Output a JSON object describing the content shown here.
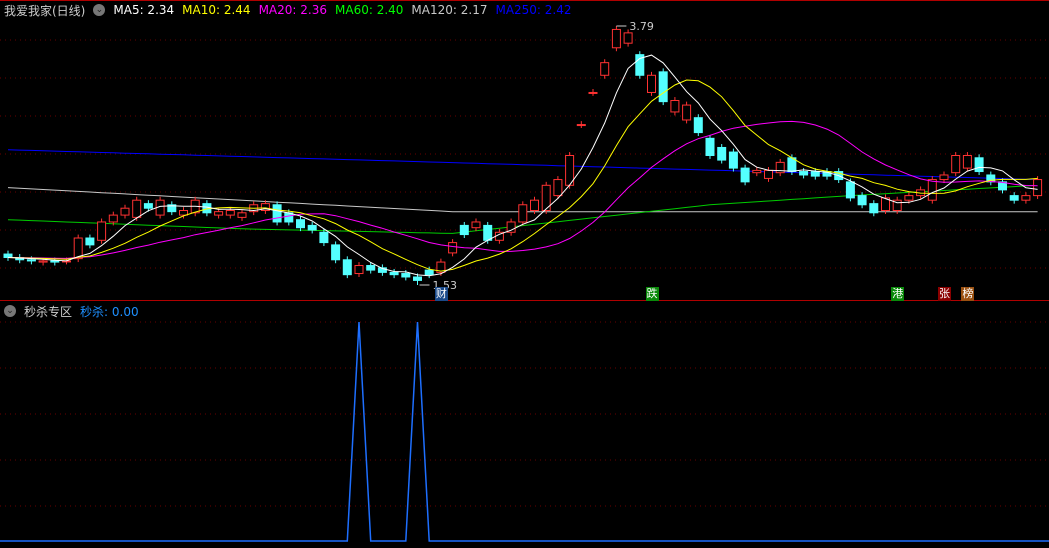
{
  "header": {
    "title": "我爱我家(日线)",
    "ma": [
      {
        "label": "MA5: 2.34",
        "color": "#ffffff"
      },
      {
        "label": "MA10: 2.44",
        "color": "#ffff00"
      },
      {
        "label": "MA20: 2.36",
        "color": "#ff00ff"
      },
      {
        "label": "MA60: 2.40",
        "color": "#00ff00"
      },
      {
        "label": "MA120: 2.17",
        "color": "#c8c8c8"
      },
      {
        "label": "MA250: 2.42",
        "color": "#0000ff"
      }
    ]
  },
  "lower_header": {
    "title": "秒杀专区",
    "indicator": "秒杀: 0.00",
    "indicator_color": "#1e90ff"
  },
  "annotations": {
    "high_label": "3.79",
    "low_label": "1.53"
  },
  "markers": [
    {
      "text": "财",
      "index": 37,
      "color": "#1a4a8a"
    },
    {
      "text": "跌",
      "index": 55,
      "color": "#0a8a0a"
    },
    {
      "text": "港",
      "index": 76,
      "color": "#0a8a0a"
    },
    {
      "text": "张",
      "index": 80,
      "color": "#8b0000"
    },
    {
      "text": "榜",
      "index": 82,
      "color": "#9a5010"
    }
  ],
  "chart_data": {
    "type": "candlestick",
    "price_range": [
      1.53,
      3.79
    ],
    "candles_open_close": [
      [
        1.8,
        1.77
      ],
      [
        1.77,
        1.75
      ],
      [
        1.75,
        1.74
      ],
      [
        1.73,
        1.74
      ],
      [
        1.74,
        1.73
      ],
      [
        1.74,
        1.74
      ],
      [
        1.76,
        1.94
      ],
      [
        1.94,
        1.88
      ],
      [
        1.92,
        2.08
      ],
      [
        2.08,
        2.14
      ],
      [
        2.14,
        2.2
      ],
      [
        2.12,
        2.27
      ],
      [
        2.24,
        2.2
      ],
      [
        2.14,
        2.27
      ],
      [
        2.23,
        2.17
      ],
      [
        2.14,
        2.18
      ],
      [
        2.16,
        2.27
      ],
      [
        2.24,
        2.16
      ],
      [
        2.14,
        2.17
      ],
      [
        2.14,
        2.18
      ],
      [
        2.12,
        2.16
      ],
      [
        2.17,
        2.23
      ],
      [
        2.18,
        2.24
      ],
      [
        2.23,
        2.08
      ],
      [
        2.16,
        2.08
      ],
      [
        2.1,
        2.03
      ],
      [
        2.05,
        2.01
      ],
      [
        1.99,
        1.9
      ],
      [
        1.88,
        1.75
      ],
      [
        1.75,
        1.62
      ],
      [
        1.63,
        1.7
      ],
      [
        1.7,
        1.66
      ],
      [
        1.68,
        1.64
      ],
      [
        1.64,
        1.62
      ],
      [
        1.63,
        1.6
      ],
      [
        1.6,
        1.57
      ],
      [
        1.66,
        1.62
      ],
      [
        1.64,
        1.73
      ],
      [
        1.81,
        1.9
      ],
      [
        2.05,
        1.97
      ],
      [
        2.03,
        2.08
      ],
      [
        2.05,
        1.92
      ],
      [
        1.92,
        1.99
      ],
      [
        1.99,
        2.08
      ],
      [
        2.08,
        2.23
      ],
      [
        2.18,
        2.27
      ],
      [
        2.18,
        2.4
      ],
      [
        2.31,
        2.45
      ],
      [
        2.4,
        2.66
      ],
      [
        2.93,
        2.93
      ],
      [
        3.21,
        3.21
      ],
      [
        3.36,
        3.47
      ],
      [
        3.6,
        3.76
      ],
      [
        3.64,
        3.73
      ],
      [
        3.54,
        3.36
      ],
      [
        3.21,
        3.36
      ],
      [
        3.39,
        3.13
      ],
      [
        3.04,
        3.14
      ],
      [
        2.97,
        3.1
      ],
      [
        2.99,
        2.86
      ],
      [
        2.81,
        2.66
      ],
      [
        2.73,
        2.62
      ],
      [
        2.69,
        2.55
      ],
      [
        2.55,
        2.43
      ],
      [
        2.51,
        2.53
      ],
      [
        2.46,
        2.53
      ],
      [
        2.51,
        2.6
      ],
      [
        2.64,
        2.52
      ],
      [
        2.52,
        2.49
      ],
      [
        2.52,
        2.48
      ],
      [
        2.52,
        2.48
      ],
      [
        2.52,
        2.45
      ],
      [
        2.43,
        2.29
      ],
      [
        2.31,
        2.23
      ],
      [
        2.24,
        2.16
      ],
      [
        2.18,
        2.29
      ],
      [
        2.18,
        2.27
      ],
      [
        2.27,
        2.31
      ],
      [
        2.31,
        2.36
      ],
      [
        2.27,
        2.45
      ],
      [
        2.45,
        2.49
      ],
      [
        2.51,
        2.66
      ],
      [
        2.55,
        2.66
      ],
      [
        2.64,
        2.52
      ],
      [
        2.49,
        2.43
      ],
      [
        2.43,
        2.36
      ],
      [
        2.31,
        2.27
      ],
      [
        2.27,
        2.31
      ],
      [
        2.31,
        2.45
      ]
    ],
    "high_index": 52,
    "high_value": 3.79,
    "low_index": 35,
    "low_value": 1.53,
    "ma250_points": [
      [
        0,
        2.71
      ],
      [
        88,
        2.45
      ]
    ],
    "ma120_points": [
      [
        0,
        2.38
      ],
      [
        38,
        2.17
      ],
      [
        88,
        2.17
      ]
    ],
    "ma60_points": [
      [
        0,
        2.1
      ],
      [
        20,
        2.02
      ],
      [
        38,
        1.98
      ],
      [
        60,
        2.23
      ],
      [
        72,
        2.31
      ],
      [
        88,
        2.4
      ]
    ],
    "lower_series": {
      "name": "秒杀",
      "spike_indices": [
        30,
        35
      ],
      "spike_value": 1,
      "range": [
        0,
        1
      ]
    }
  }
}
